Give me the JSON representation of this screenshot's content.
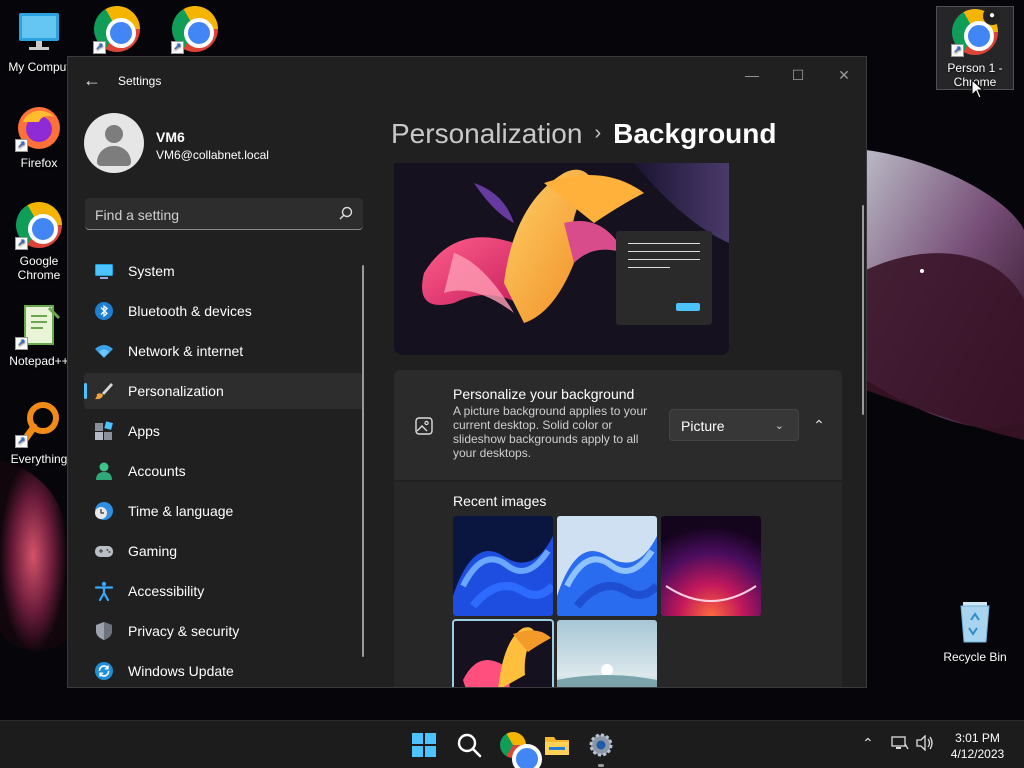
{
  "desktop": {
    "icons": [
      {
        "label": "My Comput"
      },
      {
        "label": ""
      },
      {
        "label": ""
      },
      {
        "label": "Firefox"
      },
      {
        "label": "Google Chrome"
      },
      {
        "label": "Notepad++"
      },
      {
        "label": "Everything"
      },
      {
        "label": "Person 1 - Chrome"
      },
      {
        "label": "Recycle Bin"
      }
    ]
  },
  "window": {
    "title": "Settings",
    "controls": {
      "minimize": "—",
      "maximize": "☐",
      "close": "✕"
    }
  },
  "profile": {
    "name": "VM6",
    "email": "VM6@collabnet.local"
  },
  "search": {
    "placeholder": "Find a setting"
  },
  "nav": {
    "items": [
      {
        "label": "System",
        "icon": "system-icon"
      },
      {
        "label": "Bluetooth & devices",
        "icon": "bluetooth-icon"
      },
      {
        "label": "Network & internet",
        "icon": "wifi-icon"
      },
      {
        "label": "Personalization",
        "icon": "brush-icon",
        "active": true
      },
      {
        "label": "Apps",
        "icon": "apps-icon"
      },
      {
        "label": "Accounts",
        "icon": "accounts-icon"
      },
      {
        "label": "Time & language",
        "icon": "clock-globe-icon"
      },
      {
        "label": "Gaming",
        "icon": "gamepad-icon"
      },
      {
        "label": "Accessibility",
        "icon": "accessibility-icon"
      },
      {
        "label": "Privacy & security",
        "icon": "shield-icon"
      },
      {
        "label": "Windows Update",
        "icon": "update-icon"
      }
    ]
  },
  "breadcrumb": {
    "parent": "Personalization",
    "separator": "›",
    "current": "Background"
  },
  "personalize": {
    "title": "Personalize your background",
    "description": "A picture background applies to your current desktop. Solid color or slideshow backgrounds apply to all your desktops.",
    "dropdown_value": "Picture",
    "recent_title": "Recent images"
  },
  "taskbar": {
    "apps": [
      "start-icon",
      "search-icon",
      "chrome-icon",
      "file-explorer-icon",
      "settings-icon"
    ],
    "time": "3:01 PM",
    "date": "4/12/2023"
  },
  "colors": {
    "accent": "#4cc2ff",
    "window_bg": "#202020",
    "card_bg": "#2b2b2b"
  }
}
